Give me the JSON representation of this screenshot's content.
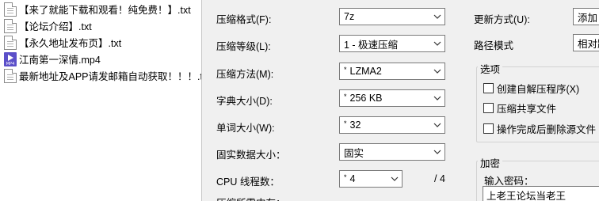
{
  "files": [
    {
      "name": "【来了就能下载和观看！纯免费！】.txt",
      "type": "txt"
    },
    {
      "name": "【论坛介绍】.txt",
      "type": "txt"
    },
    {
      "name": "【永久地址发布页】.txt",
      "type": "txt"
    },
    {
      "name": "江南第一深情.mp4",
      "type": "mp4"
    },
    {
      "name": "最新地址及APP请发邮箱自动获取！！！.txt",
      "type": "txt"
    }
  ],
  "mp4_icon_text": "MP4",
  "settings": {
    "format_label": "压缩格式(F):",
    "format_value": "7z",
    "level_label": "压缩等级(L):",
    "level_value": "1 - 极速压缩",
    "method_label": "压缩方法(M):",
    "method_value": "LZMA2",
    "dict_label": "字典大小(D):",
    "dict_value": "256 KB",
    "word_label": "单词大小(W):",
    "word_value": "32",
    "solid_label": "固实数据大小：",
    "solid_value": "固实",
    "cpu_label": "CPU 线程数：",
    "cpu_value": "4",
    "cpu_total": "/ 4",
    "memory_label": "压缩所需内存："
  },
  "right": {
    "update_label": "更新方式(U):",
    "update_value": "添加",
    "path_label": "路径模式",
    "path_value": "相对路",
    "options_title": "选项",
    "opt_sfx": "创建自解压程序(X)",
    "opt_shared": "压缩共享文件",
    "opt_delete": "操作完成后删除源文件",
    "encrypt_title": "加密",
    "password_label": "输入密码：",
    "password_value": "上老王论坛当老王"
  },
  "star": "*"
}
